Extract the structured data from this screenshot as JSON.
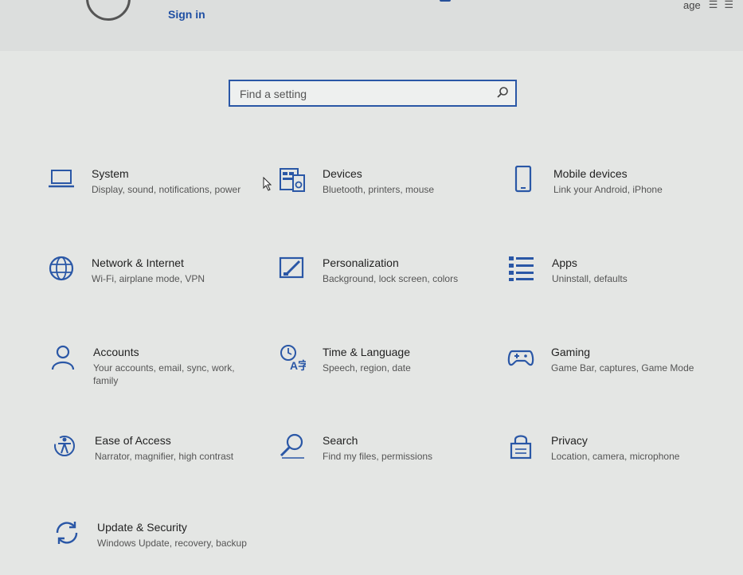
{
  "header": {
    "signin_label": "Sign in",
    "right_label": "age"
  },
  "search": {
    "placeholder": "Find a setting"
  },
  "tiles": [
    {
      "title": "System",
      "desc": "Display, sound, notifications, power",
      "icon": "laptop-icon"
    },
    {
      "title": "Devices",
      "desc": "Bluetooth, printers, mouse",
      "icon": "keyboard-speaker-icon"
    },
    {
      "title": "Mobile devices",
      "desc": "Link your Android, iPhone",
      "icon": "phone-icon"
    },
    {
      "title": "Network & Internet",
      "desc": "Wi-Fi, airplane mode, VPN",
      "icon": "globe-icon"
    },
    {
      "title": "Personalization",
      "desc": "Background, lock screen, colors",
      "icon": "paint-icon"
    },
    {
      "title": "Apps",
      "desc": "Uninstall, defaults",
      "icon": "apps-list-icon"
    },
    {
      "title": "Accounts",
      "desc": "Your accounts, email, sync, work, family",
      "icon": "person-icon"
    },
    {
      "title": "Time & Language",
      "desc": "Speech, region, date",
      "icon": "time-language-icon"
    },
    {
      "title": "Gaming",
      "desc": "Game Bar, captures, Game Mode",
      "icon": "gamepad-icon"
    },
    {
      "title": "Ease of Access",
      "desc": "Narrator, magnifier, high contrast",
      "icon": "ease-of-access-icon"
    },
    {
      "title": "Search",
      "desc": "Find my files, permissions",
      "icon": "search-icon"
    },
    {
      "title": "Privacy",
      "desc": "Location, camera, microphone",
      "icon": "lock-icon"
    },
    {
      "title": "Update & Security",
      "desc": "Windows Update, recovery, backup",
      "icon": "update-icon"
    }
  ],
  "colors": {
    "accent": "#2a57a6",
    "background": "#e4e6e4"
  }
}
